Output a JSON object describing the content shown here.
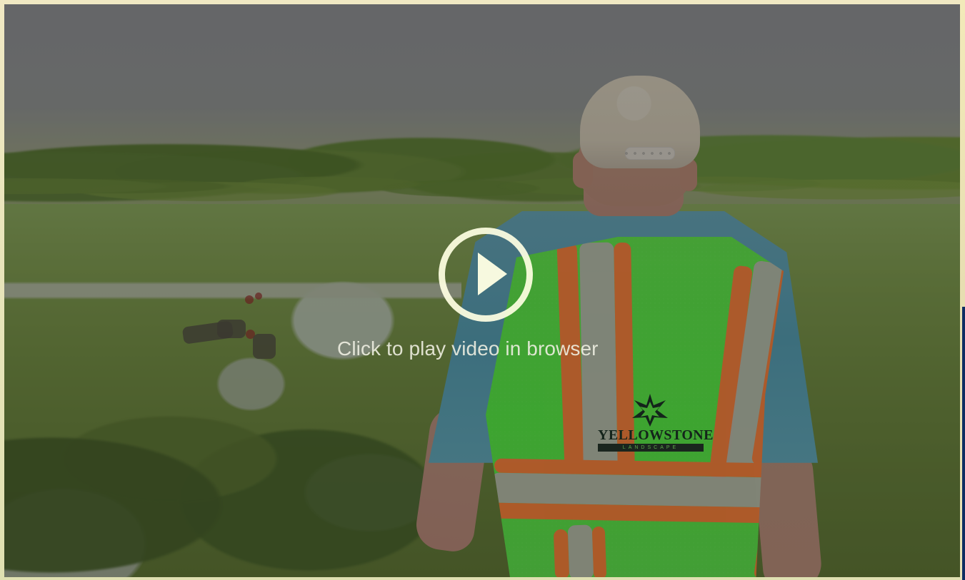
{
  "video": {
    "play_text": "Click to play video in browser",
    "icon": "play-icon",
    "overlay_color": "#212121"
  },
  "branding": {
    "logo_title": "YELLOWSTONE",
    "logo_subtitle": "LANDSCAPE",
    "vest_color": "#4ef037",
    "stripe_color": "#ff7b2e"
  },
  "colors": {
    "page_background": "#e9dfb4",
    "right_edge_accent": "#0f2d62",
    "play_color": "#ffffe3"
  }
}
